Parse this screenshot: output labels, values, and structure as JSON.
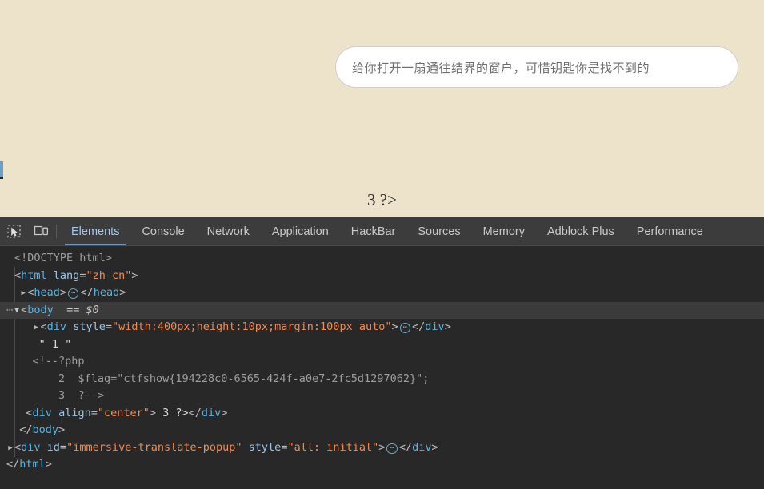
{
  "page": {
    "bubble_text": "给你打开一扇通往结界的窗户，可惜钥匙你是找不到的",
    "center_text": "3 ?>",
    "background_color": "#ede3cb",
    "bubble_background": "#ffffff",
    "bubble_border_color": "#cfcfcf"
  },
  "devtools": {
    "accent_color": "#5a9bea",
    "background_color": "#282828",
    "toolbar_background": "#3c3c3c",
    "icons": {
      "inspect": "inspect-element-icon",
      "device": "device-toolbar-icon"
    },
    "tabs": [
      {
        "label": "Elements",
        "active": true
      },
      {
        "label": "Console",
        "active": false
      },
      {
        "label": "Network",
        "active": false
      },
      {
        "label": "Application",
        "active": false
      },
      {
        "label": "HackBar",
        "active": false
      },
      {
        "label": "Sources",
        "active": false
      },
      {
        "label": "Memory",
        "active": false
      },
      {
        "label": "Adblock Plus",
        "active": false
      },
      {
        "label": "Performance",
        "active": false
      }
    ],
    "tree": {
      "doctype": "<!DOCTYPE html>",
      "html_open_tag": "html",
      "html_lang_attr": "lang",
      "html_lang_value": "\"zh-cn\"",
      "head_tag": "head",
      "body_tag": "body",
      "body_selected_marker": "== $0",
      "div_tag": "div",
      "style_attr": "style",
      "style_value": "\"width:400px;height:10px;margin:100px auto\"",
      "text_node": "\" 1 \"",
      "comment_line1": "<!--?php",
      "comment_line2_number": "2",
      "comment_line2_code": "$flag=\"ctfshow{194228c0-6565-424f-a0e7-2fc5d1297062}\";",
      "comment_line3_number": "3",
      "comment_line3_code": "?-->",
      "align_attr": "align",
      "align_value": "\"center\"",
      "div_center_content": " 3 ?>",
      "popup_id_attr": "id",
      "popup_id_value": "\"immersive-translate-popup\"",
      "popup_style_value": "\"all: initial\"",
      "flag": "ctfshow{194228c0-6565-424f-a0e7-2fc5d1297062}"
    }
  }
}
